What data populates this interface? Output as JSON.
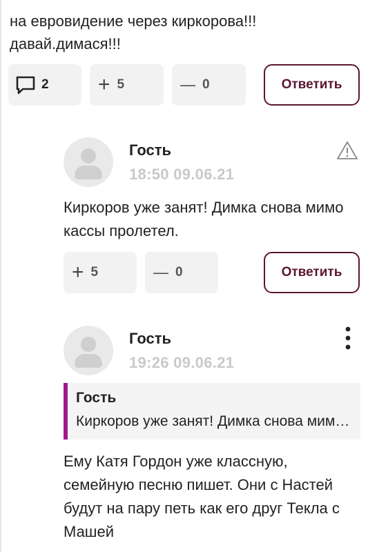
{
  "top_comment": {
    "text": "на евровидение через киркорова!!! давай.димася!!!",
    "comments_count": "2",
    "plus_count": "5",
    "minus_count": "0",
    "reply_label": "Ответить"
  },
  "reply1": {
    "author": "Гость",
    "time": "18:50 09.06.21",
    "text": "Киркоров уже занят! Димка снова мимо кассы пролетел.",
    "plus_count": "5",
    "minus_count": "0",
    "reply_label": "Ответить"
  },
  "reply2": {
    "author": "Гость",
    "time": "19:26 09.06.21",
    "quote_author": "Гость",
    "quote_text": "Киркоров уже занят! Димка снова мимо кассы пролетел.",
    "text": "Ему Катя Гордон уже классную, семейную песню пишет. Они с Настей будут на пару петь как его друг Текла с Машей"
  },
  "icons": {
    "plus": "+",
    "minus": "—"
  },
  "colors": {
    "accent": "#5a1530",
    "quote_bar": "#a3168a",
    "pill_bg": "#f2f2f2",
    "time": "#c9c9c9"
  }
}
